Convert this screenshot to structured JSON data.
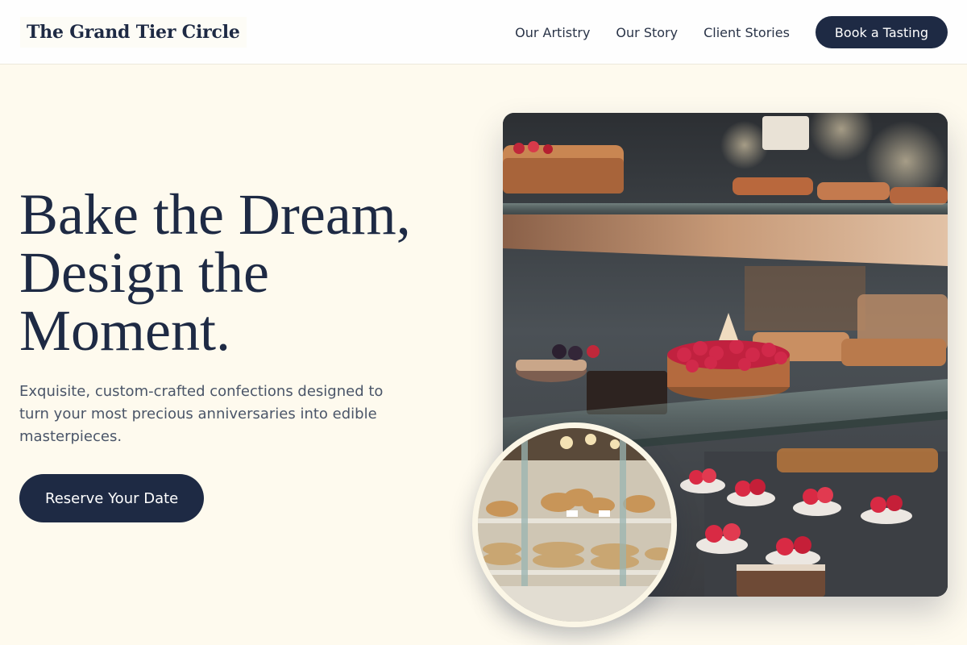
{
  "brand": {
    "name": "The Grand Tier Circle"
  },
  "nav": {
    "links": [
      "Our Artistry",
      "Our Story",
      "Client Stories"
    ],
    "cta": "Book a Tasting"
  },
  "hero": {
    "title_lines": [
      "Bake the Dream,",
      "Design the",
      "Moment."
    ],
    "subtitle": "Exquisite, custom-crafted confections designed to turn your most precious anniversaries into edible masterpieces.",
    "cta": "Reserve Your Date"
  },
  "images": {
    "main_photo": "bakery-display-case-photo",
    "inset_photo": "pastry-shelves-photo"
  },
  "colors": {
    "background": "#fefaee",
    "navy": "#1e2a44",
    "text_muted": "#4a5568",
    "header_bg": "#fefefe"
  }
}
